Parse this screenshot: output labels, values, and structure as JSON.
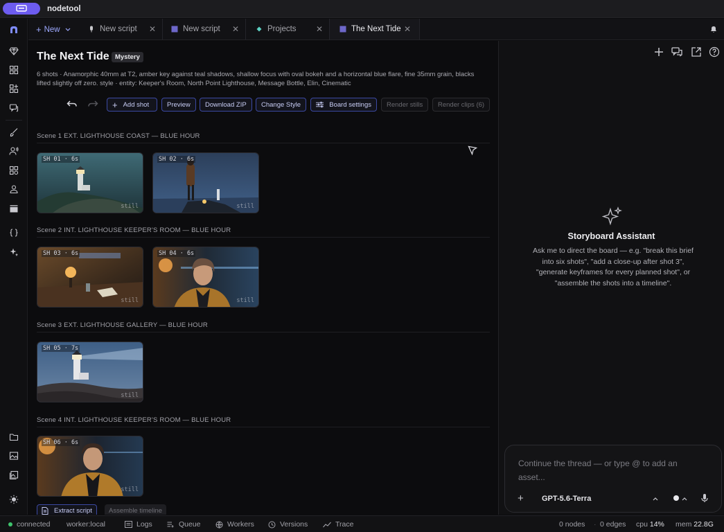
{
  "app": {
    "name": "nodetool"
  },
  "tabs": {
    "new_label": "New",
    "items": [
      {
        "label": "New script",
        "icon": "script-icon"
      },
      {
        "label": "New script",
        "icon": "storyboard-icon"
      },
      {
        "label": "Projects",
        "icon": "diamond-icon"
      },
      {
        "label": "The Next Tide",
        "icon": "storyboard-icon",
        "active": true
      }
    ]
  },
  "board": {
    "title": "The Next Tide",
    "genre": "Mystery",
    "description": "6 shots · Anamorphic 40mm at T2, amber key against teal shadows, shallow focus with oval bokeh and a horizontal blue flare, fine 35mm grain, blacks lifted slightly off zero. style · entity: Keeper's Room, North Point Lighthouse, Message Bottle, Elin, Cinematic"
  },
  "toolbar": {
    "add_shot": "Add shot",
    "preview": "Preview",
    "download_zip": "Download ZIP",
    "change_style": "Change Style",
    "board_settings": "Board settings",
    "render_stills": "Render stills",
    "render_clips": "Render clips (6)"
  },
  "scenes": [
    {
      "header": "Scene  1  EXT. LIGHTHOUSE COAST — BLUE HOUR",
      "shots": [
        {
          "label": "SH 01 · 6s",
          "still": "still"
        },
        {
          "label": "SH 02 · 6s",
          "still": "still"
        }
      ]
    },
    {
      "header": "Scene  2  INT. LIGHTHOUSE KEEPER'S ROOM — BLUE HOUR",
      "shots": [
        {
          "label": "SH 03 · 6s",
          "still": "still"
        },
        {
          "label": "SH 04 · 6s",
          "still": "still"
        }
      ]
    },
    {
      "header": "Scene  3  EXT. LIGHTHOUSE GALLERY — BLUE HOUR",
      "shots": [
        {
          "label": "SH 05 · 7s",
          "still": "still"
        }
      ]
    },
    {
      "header": "Scene  4  INT. LIGHTHOUSE KEEPER'S ROOM — BLUE HOUR",
      "shots": [
        {
          "label": "SH 06 · 6s",
          "still": "still"
        }
      ]
    }
  ],
  "footer_buttons": {
    "extract_script": "Extract script",
    "assemble_timeline": "Assemble timeline"
  },
  "assistant": {
    "title": "Storyboard Assistant",
    "text": "Ask me to direct the board — e.g. \"break this brief into six shots\", \"add a close-up after shot 3\", \"generate keyframes for every planned shot\", or \"assemble the shots into a timeline\".",
    "placeholder": "Continue the thread — or type @ to add an asset...",
    "model": "GPT-5.6-Terra"
  },
  "status": {
    "connection": "connected",
    "worker": "worker:local",
    "logs": "Logs",
    "queue": "Queue",
    "workers": "Workers",
    "versions": "Versions",
    "trace": "Trace",
    "nodes_value": "0",
    "nodes_label": "nodes",
    "edges_value": "0",
    "edges_label": "edges",
    "cpu_label": "cpu",
    "cpu_value": "14%",
    "mem_label": "mem",
    "mem_value": "22.8G"
  },
  "colors": {
    "accent": "#6d5cf0",
    "connected": "#3ec46d",
    "button_border": "#3c4aa4"
  }
}
